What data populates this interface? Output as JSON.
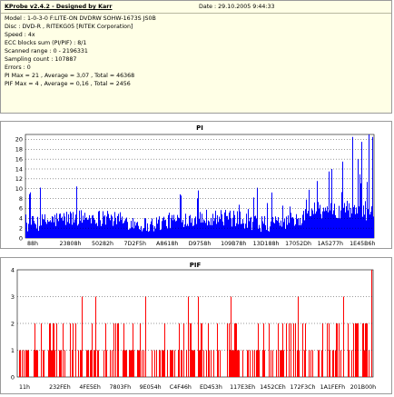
{
  "header": {
    "title": "KProbe v2.4.2 - Designed by Karr",
    "date": "Date : 29.10.2005 9:44:33"
  },
  "info_lines": [
    "Model : 1-0-3-0 F:LITE-ON DVDRW SOHW-1673S JS0B",
    "Disc : DVD-R , RITEKG05 [RITEK Corporation]",
    "Speed : 4x",
    "ECC blocks sum (PI/PIF) : 8/1",
    "Scanned range : 0 - 2196331",
    "Sampling count : 107887",
    "Errors : 0",
    "PI Max = 21 , Average = 3,07 , Total = 46368",
    "PIF Max = 4 , Average = 0,16 , Total = 2456"
  ],
  "chart_data": [
    {
      "type": "bar",
      "title": "PI",
      "ylim": [
        0,
        21
      ],
      "yticks": [
        0,
        2,
        4,
        6,
        8,
        10,
        12,
        14,
        16,
        18,
        20
      ],
      "grid": true,
      "color": "#0000ff",
      "x_tick_labels": [
        "88h",
        "23808h",
        "50282h",
        "7D2F5h",
        "A8618h",
        "D9758h",
        "109B78h",
        "13D188h",
        "17052Dh",
        "1A5277h",
        "1E45B6h"
      ],
      "x_range": [
        136,
        2196331
      ],
      "base_level": 3.07,
      "max": 21,
      "note_on_values": "dense per-sample series (107887 samples), average 3.07, max 21; spikes up to ~20 near the end"
    },
    {
      "type": "bar",
      "title": "PIF",
      "ylim": [
        0,
        4
      ],
      "yticks": [
        0,
        1,
        2,
        3,
        4
      ],
      "grid": true,
      "color": "#ff0000",
      "x_tick_labels": [
        "11h",
        "232FEh",
        "4FE5Eh",
        "7803Fh",
        "9E054h",
        "C4F46h",
        "ED453h",
        "117E3Eh",
        "1452CEh",
        "172F3Ch",
        "1A1FEFh",
        "201B00h"
      ],
      "x_range": [
        17,
        2196331
      ],
      "base_level": 0.16,
      "max": 4,
      "note_on_values": "dense series of mostly 0/1 values with values 2 and occasional 3, one 4 at end"
    }
  ]
}
